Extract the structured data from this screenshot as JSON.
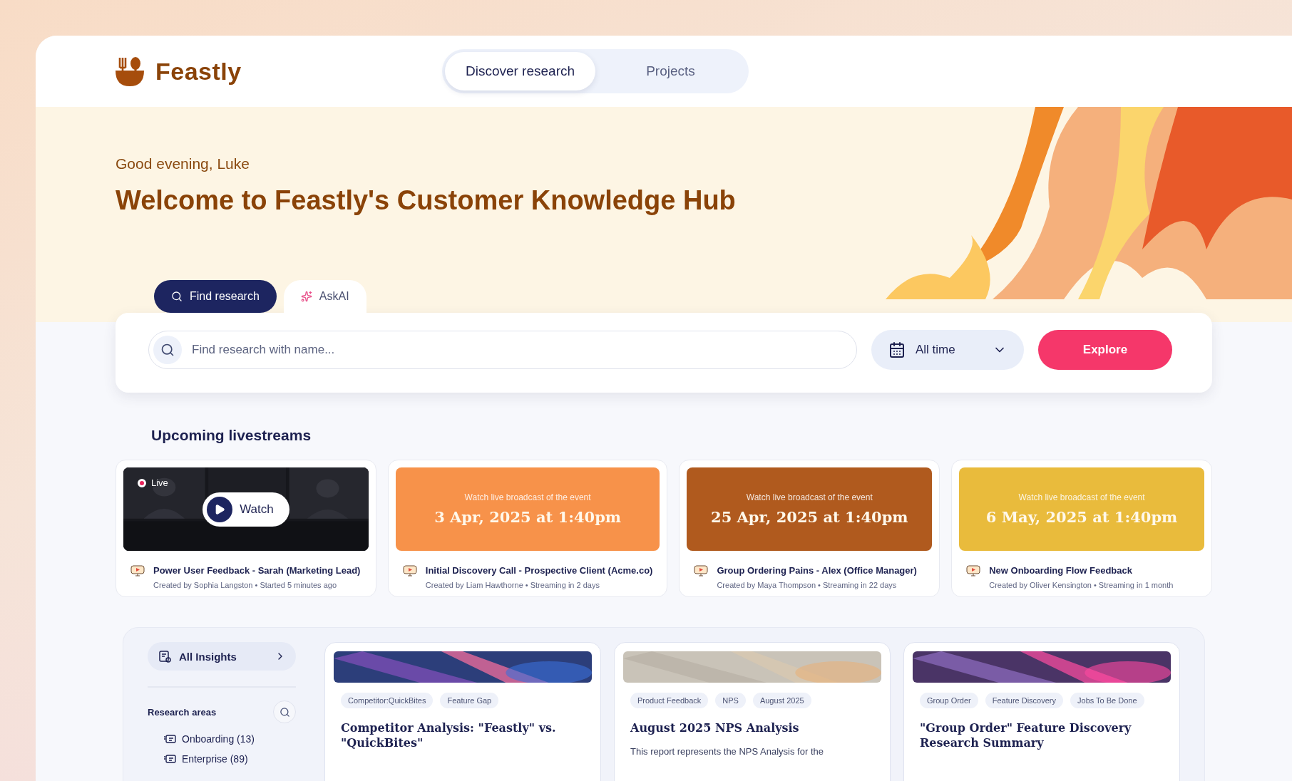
{
  "header": {
    "brand": "Feastly",
    "nav": [
      {
        "label": "Discover research",
        "selected": true
      },
      {
        "label": "Projects",
        "selected": false
      }
    ]
  },
  "hero": {
    "greeting": "Good evening, Luke",
    "title": "Welcome to Feastly's Customer Knowledge Hub"
  },
  "search": {
    "modes": [
      {
        "label": "Find research",
        "kind": "search",
        "selected": true
      },
      {
        "label": "AskAI",
        "kind": "ai",
        "selected": false
      }
    ],
    "placeholder": "Find research with name...",
    "date_filter": "All time",
    "button": "Explore"
  },
  "livestreams": {
    "heading": "Upcoming livestreams",
    "items": [
      {
        "kind": "live",
        "live_label": "Live",
        "watch_label": "Watch",
        "title": "Power User Feedback - Sarah (Marketing Lead)",
        "meta": "Created by Sophia Langston • Started 5 minutes ago"
      },
      {
        "kind": "scheduled",
        "color": "#f7924a",
        "caption": "Watch live broadcast of the event",
        "date": "3 Apr, 2025 at 1:40pm",
        "title": "Initial Discovery Call - Prospective Client (Acme.co)",
        "meta": "Created by Liam Hawthorne • Streaming in 2 days"
      },
      {
        "kind": "scheduled",
        "color": "#b05a1e",
        "caption": "Watch live broadcast of the event",
        "date": "25 Apr, 2025 at 1:40pm",
        "title": "Group Ordering Pains - Alex (Office Manager)",
        "meta": "Created by Maya Thompson • Streaming in 22 days"
      },
      {
        "kind": "scheduled",
        "color": "#e9bb3c",
        "caption": "Watch live broadcast of the event",
        "date": "6 May, 2025 at 1:40pm",
        "title": "New Onboarding Flow Feedback",
        "meta": "Created by Oliver Kensington • Streaming in 1 month"
      }
    ]
  },
  "sidebar": {
    "all_insights": "All Insights",
    "areas_label": "Research areas",
    "areas": [
      "Onboarding (13)",
      "Enterprise (89)"
    ]
  },
  "reports": [
    {
      "tags": [
        "Competitor:QuickBites",
        "Feature Gap"
      ],
      "title": "Competitor Analysis: \"Feastly\" vs. \"QuickBites\""
    },
    {
      "tags": [
        "Product Feedback",
        "NPS",
        "August 2025"
      ],
      "title": "August 2025 NPS Analysis",
      "description": "This report represents the NPS Analysis for the"
    },
    {
      "tags": [
        "Group Order",
        "Feature Discovery",
        "Jobs To Be Done"
      ],
      "title": "\"Group Order\" Feature Discovery Research Summary"
    }
  ]
}
